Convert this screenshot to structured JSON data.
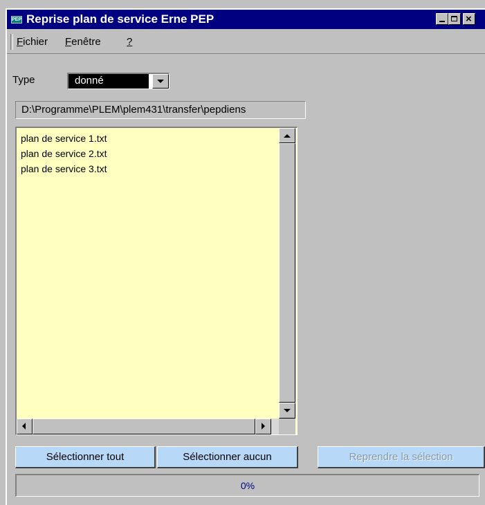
{
  "window": {
    "title": "Reprise plan de service Erne PEP",
    "icon_text": "PEP",
    "controls": {
      "minimize": "minimize-icon",
      "maximize": "maximize-icon",
      "close": "close-icon"
    }
  },
  "menu": {
    "items": [
      {
        "label": "Fichier",
        "accel": "F",
        "rest": "ichier"
      },
      {
        "label": "Fenêtre",
        "accel": "F",
        "rest": "enêtre"
      },
      {
        "label": "?",
        "accel": "?",
        "rest": ""
      }
    ]
  },
  "type": {
    "label": "Type",
    "selected": "donné"
  },
  "path": "D:\\Programme\\PLEM\\plem431\\transfer\\pepdiens",
  "files": [
    "plan de service 1.txt",
    "plan de service 2.txt",
    "plan de service 3.txt"
  ],
  "buttons": {
    "select_all": "Sélectionner tout",
    "select_none": "Sélectionner aucun",
    "resume_selection": "Reprendre la sélection"
  },
  "progress": {
    "value": 0,
    "text": "0%"
  },
  "colors": {
    "titlebar": "#000080",
    "list_background": "#ffffc0",
    "button_background": "#b8d8f8",
    "window_background": "#c0c0c0"
  }
}
